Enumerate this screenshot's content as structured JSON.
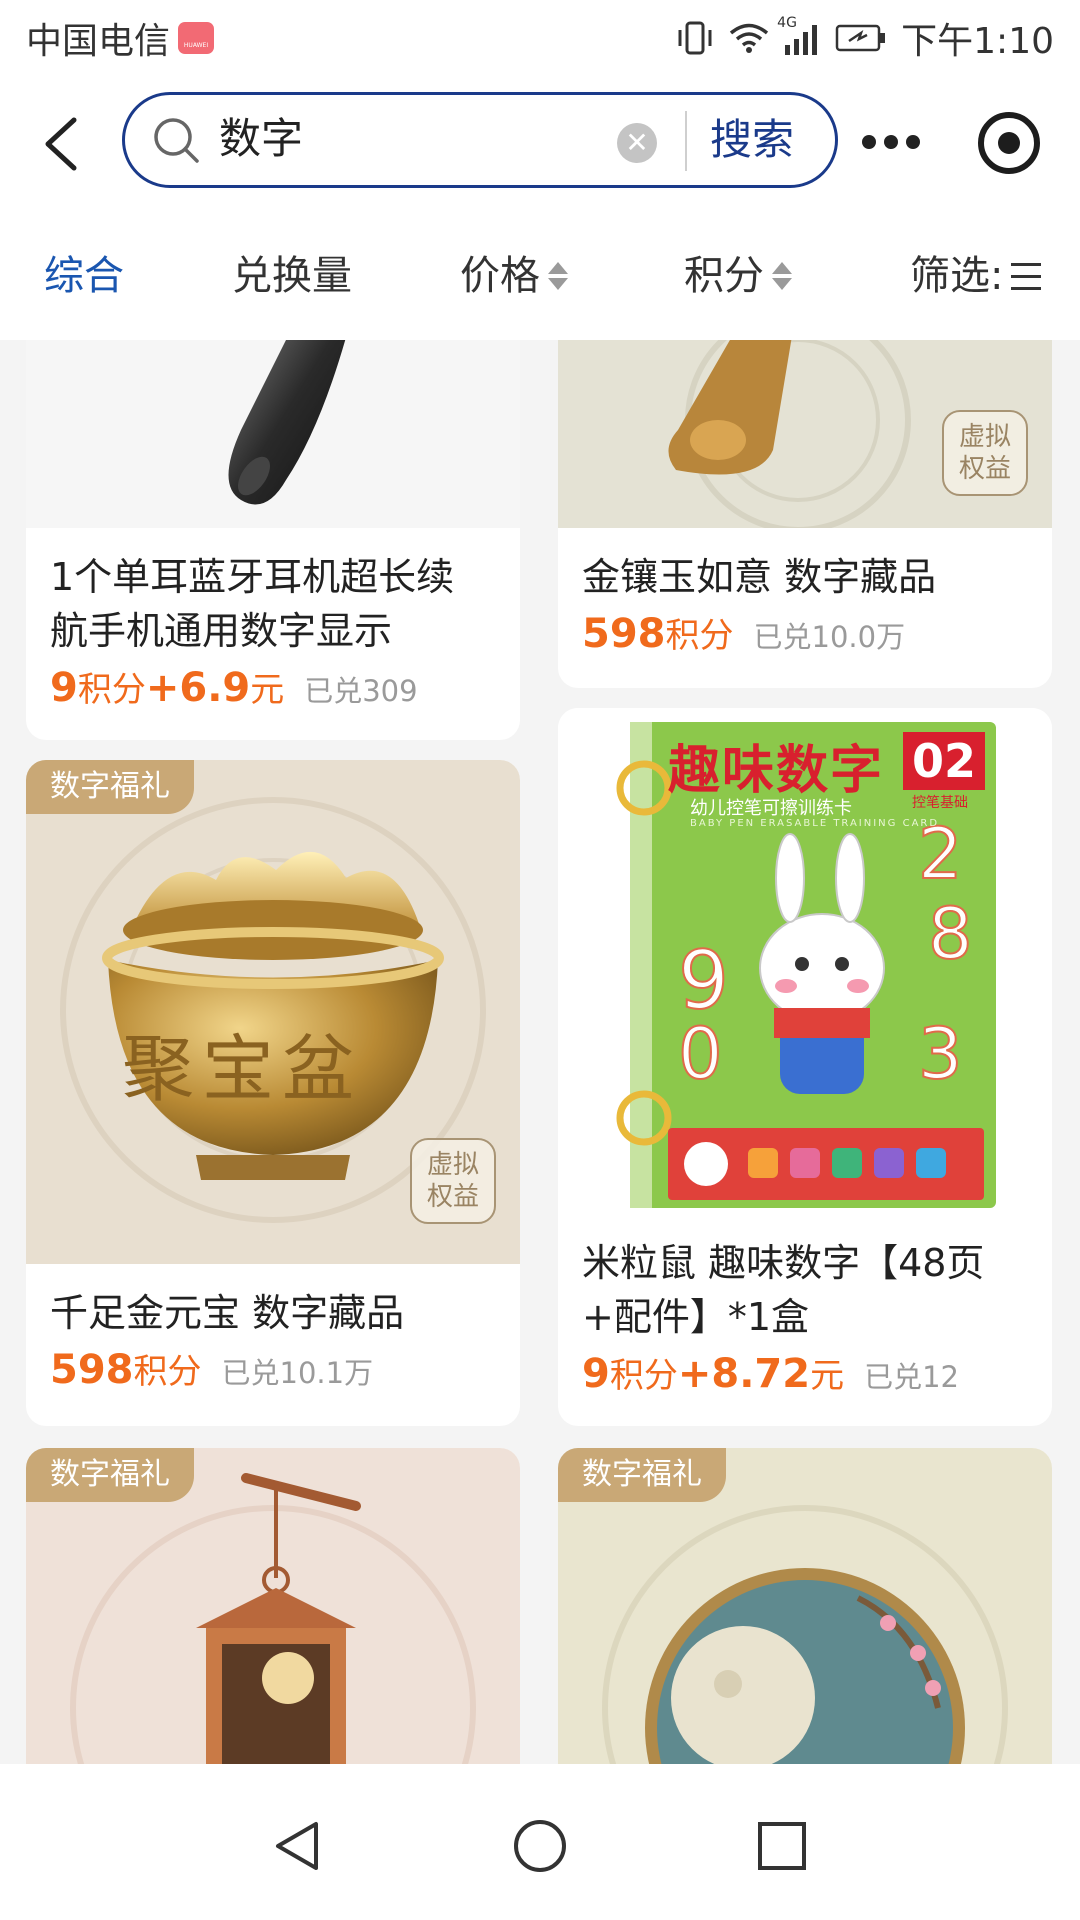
{
  "status_bar": {
    "carrier": "中国电信",
    "carrier_badge": "HUAWEI",
    "network": "4G",
    "time": "下午1:10"
  },
  "search": {
    "query": "数字",
    "submit_label": "搜索"
  },
  "sort_tabs": [
    {
      "label": "综合",
      "active": true
    },
    {
      "label": "兑换量"
    },
    {
      "label": "价格"
    },
    {
      "label": "积分"
    },
    {
      "label": "筛选:"
    }
  ],
  "products": [
    {
      "title_line1": "1个单耳蓝牙耳机超长续",
      "title_line2": "航手机通用数字显示",
      "price": "9",
      "price_unit": "积分",
      "price_extra": "+6.9",
      "price_extra_unit": "元",
      "redeemed": "已兑309"
    },
    {
      "title_line1": "金镶玉如意 数字藏品",
      "price": "598",
      "price_unit": "积分",
      "redeemed": "已兑10.0万",
      "stamp": [
        "虚拟",
        "权益"
      ]
    },
    {
      "tag": "数字福礼",
      "title_line1": "千足金元宝 数字藏品",
      "price": "598",
      "price_unit": "积分",
      "redeemed": "已兑10.1万",
      "stamp": [
        "虚拟",
        "权益"
      ],
      "image_text": "聚宝盆"
    },
    {
      "title_line1": "米粒鼠 趣味数字【48页",
      "title_line2": "+配件】*1盒",
      "price": "9",
      "price_unit": "积分",
      "price_extra": "+8.72",
      "price_extra_unit": "元",
      "redeemed": "已兑12",
      "cover": {
        "title": "趣味数字",
        "number": "02",
        "badge": "控笔基础",
        "subtitle": "幼儿控笔可擦训练卡",
        "subtitle_en": "BABY PEN ERASABLE TRAINING CARD"
      }
    },
    {
      "tag": "数字福礼"
    },
    {
      "tag": "数字福礼"
    }
  ],
  "colors": {
    "accent": "#1a3a8a",
    "active_tab": "#1a56b0",
    "price": "#f06a1c",
    "tag": "#c9a876"
  }
}
